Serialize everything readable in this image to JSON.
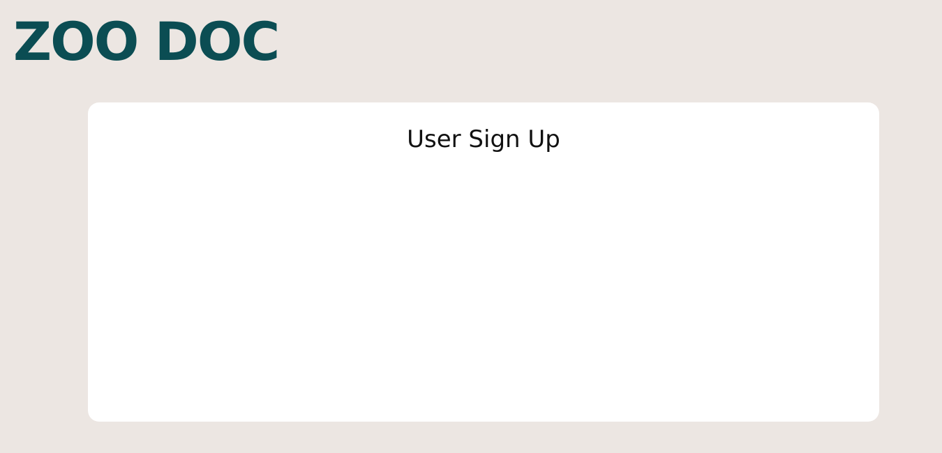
{
  "app": {
    "brand": "ZOO DOC"
  },
  "signup": {
    "title": "User Sign Up"
  },
  "colors": {
    "background": "#ece6e2",
    "brand": "#0b4d53",
    "card": "#ffffff",
    "title_text": "#111111"
  }
}
